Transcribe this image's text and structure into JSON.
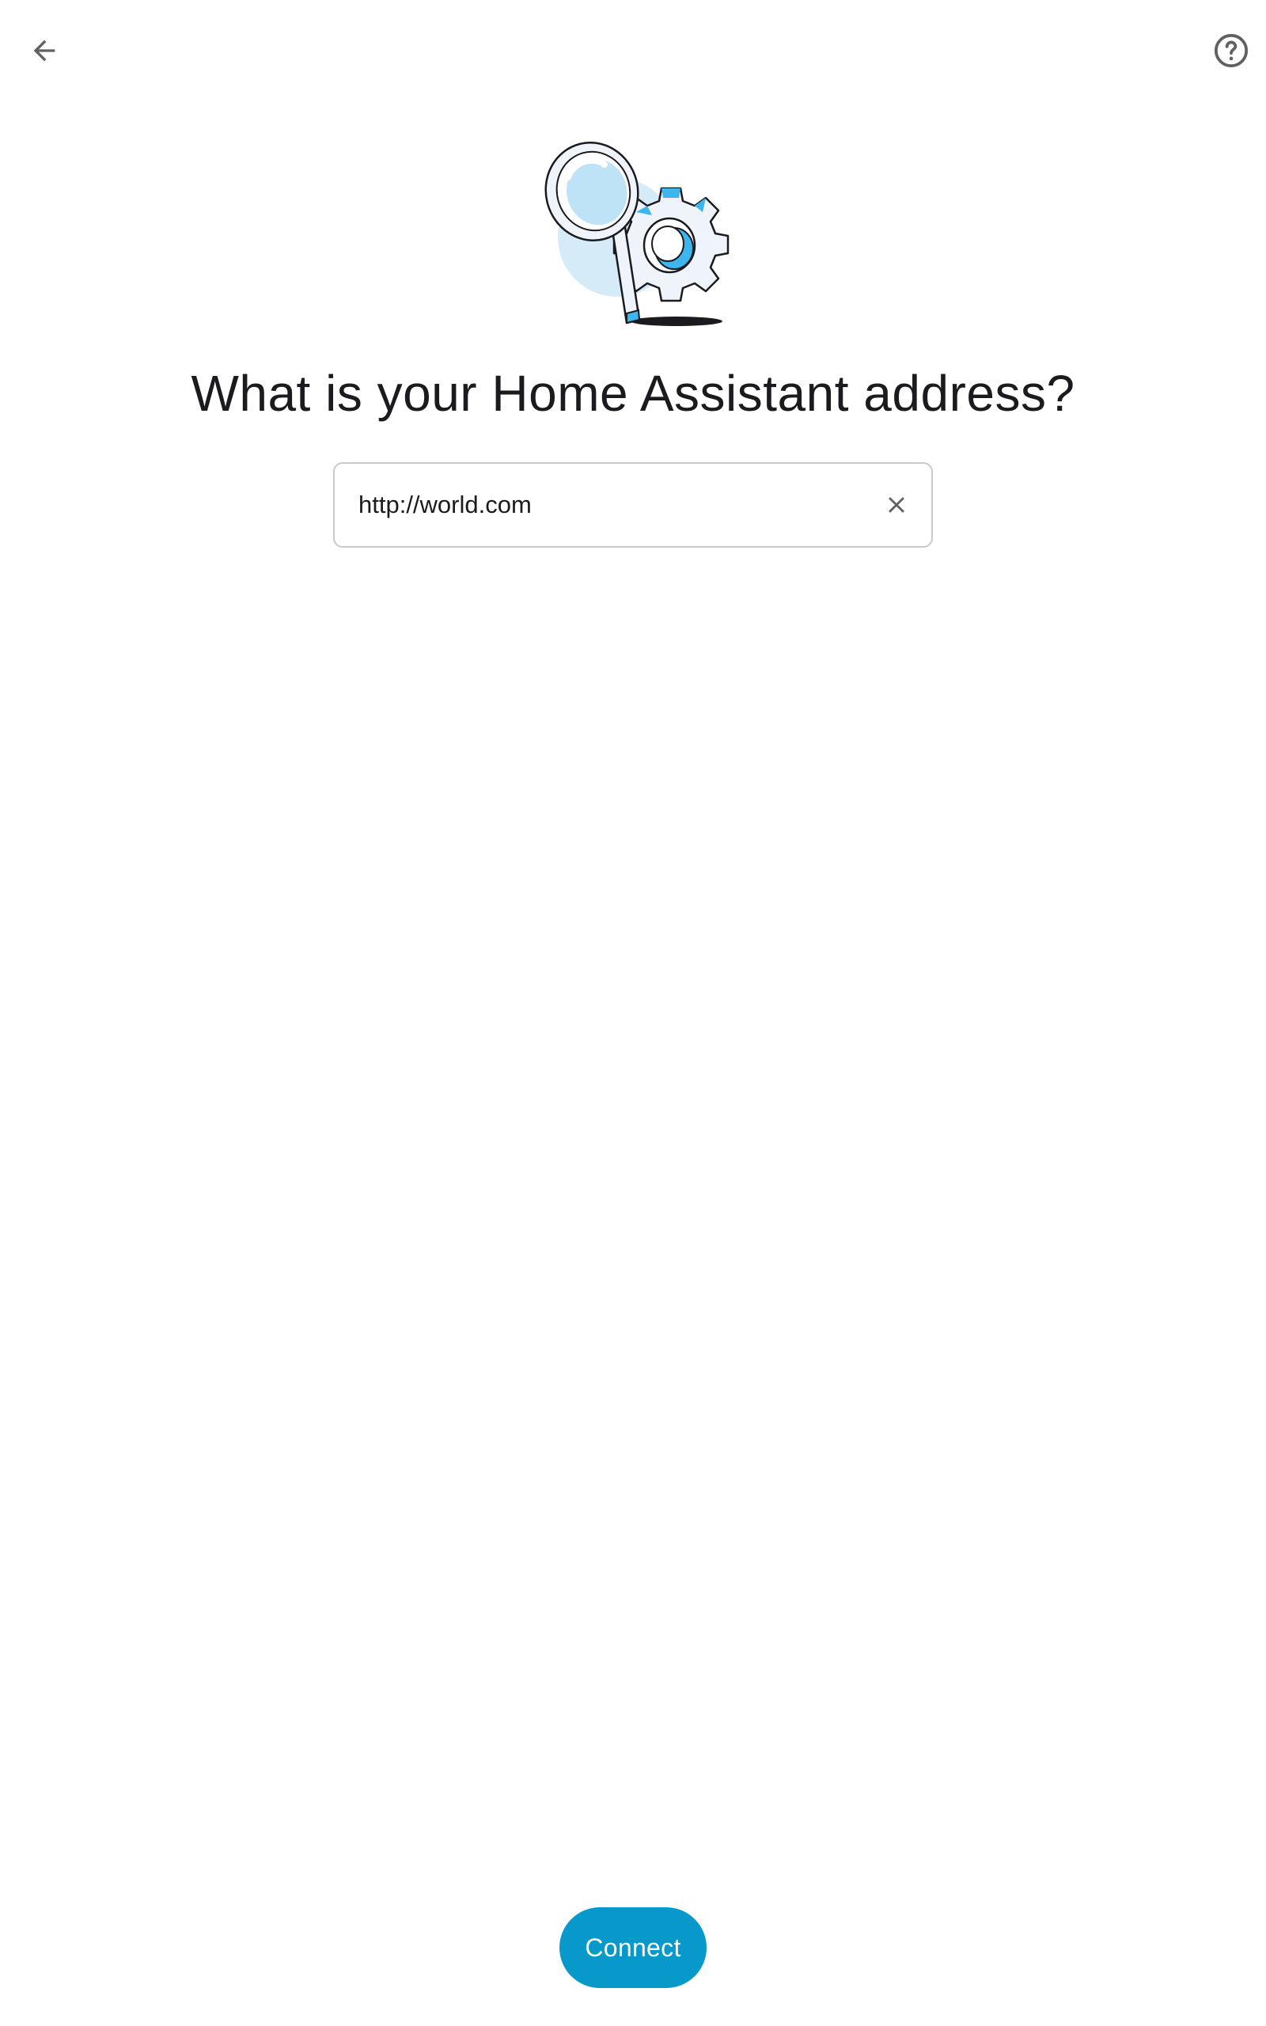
{
  "header": {
    "back_icon": "arrow-left-icon",
    "help_icon": "help-circle-icon"
  },
  "illustration": {
    "icon": "magnifier-gear-illustration"
  },
  "main": {
    "title": "What is your Home Assistant address?",
    "url_field": {
      "value": "http://world.com",
      "clear_icon": "close-icon"
    }
  },
  "footer": {
    "connect_label": "Connect"
  },
  "colors": {
    "accent": "#0699C9",
    "icon_gray": "#616161",
    "border": "#C9C9CE",
    "illustration_blue": "#3DB6EE",
    "illustration_light": "#D5ECF8"
  }
}
